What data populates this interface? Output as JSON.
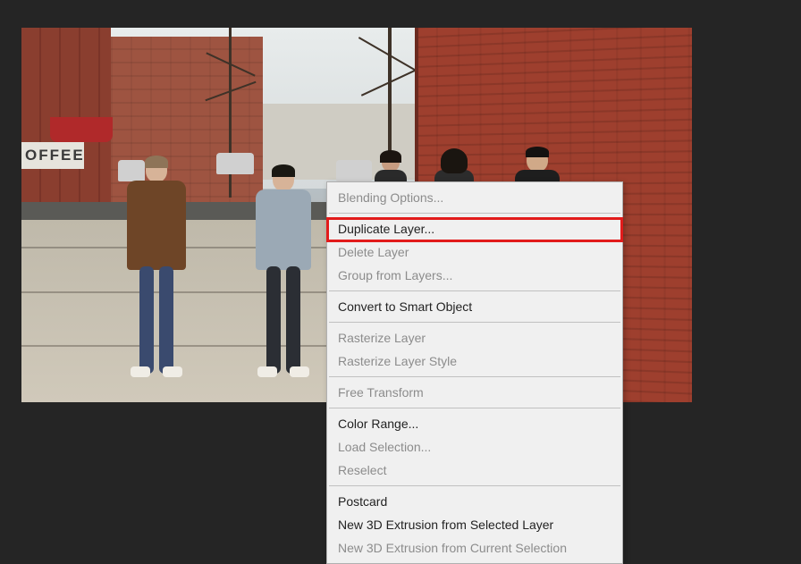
{
  "coffee_sign": "OFFEE",
  "menu": {
    "blending_options": "Blending Options...",
    "duplicate_layer": "Duplicate Layer...",
    "delete_layer": "Delete Layer",
    "group_from_layers": "Group from Layers...",
    "convert_smart_object": "Convert to Smart Object",
    "rasterize_layer": "Rasterize Layer",
    "rasterize_layer_style": "Rasterize Layer Style",
    "free_transform": "Free Transform",
    "color_range": "Color Range...",
    "load_selection": "Load Selection...",
    "reselect": "Reselect",
    "postcard": "Postcard",
    "new_3d_extrusion_selected": "New 3D Extrusion from Selected Layer",
    "new_3d_extrusion_current": "New 3D Extrusion from Current Selection"
  },
  "highlighted_item": "duplicate_layer"
}
